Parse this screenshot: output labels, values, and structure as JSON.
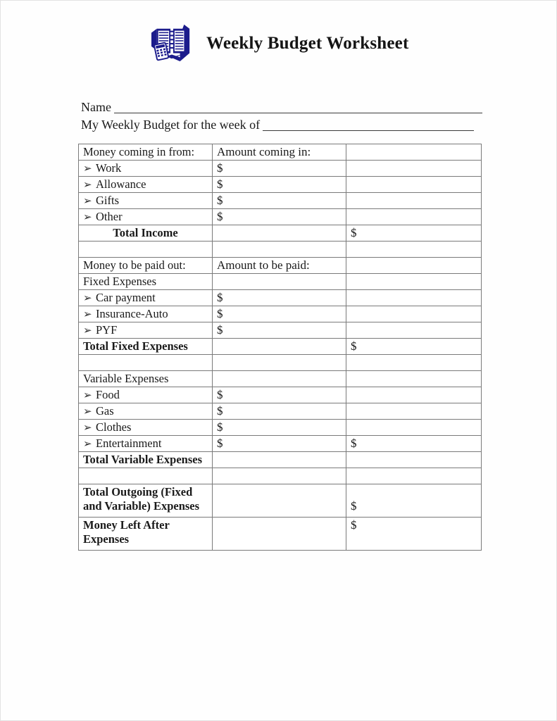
{
  "document": {
    "title": "Weekly Budget Worksheet",
    "logo_icon": "budget-book-calculator-icon",
    "logo_color": "#1c1c8c"
  },
  "fields": [
    {
      "label": "Name",
      "value": "",
      "rule": "long"
    },
    {
      "label": "My Weekly Budget for the week of",
      "value": "",
      "rule": "short"
    }
  ],
  "table": {
    "bullet_glyph": "➢",
    "currency_symbol": "$",
    "rows": [
      {
        "type": "header",
        "name": "income-header",
        "c1": "Money coming in from:",
        "c2": "Amount coming in:",
        "c3": ""
      },
      {
        "type": "bullet",
        "name": "income-work",
        "c1": "Work",
        "c2": "$",
        "c3": ""
      },
      {
        "type": "bullet",
        "name": "income-allowance",
        "c1": "Allowance",
        "c2": "$",
        "c3": ""
      },
      {
        "type": "bullet",
        "name": "income-gifts",
        "c1": "Gifts",
        "c2": "$",
        "c3": ""
      },
      {
        "type": "bullet",
        "name": "income-other",
        "c1": "Other",
        "c2": "$",
        "c3": ""
      },
      {
        "type": "total-center",
        "name": "total-income",
        "c1": "Total Income",
        "c2": "",
        "c3": "$"
      },
      {
        "type": "spacer",
        "name": "spacer-1",
        "c1": "",
        "c2": "",
        "c3": ""
      },
      {
        "type": "header",
        "name": "outgoing-header",
        "c1": "Money to be paid out:",
        "c2": "Amount to be paid:",
        "c3": ""
      },
      {
        "type": "sub",
        "name": "fixed-expenses-group",
        "c1": "Fixed Expenses",
        "c2": "",
        "c3": ""
      },
      {
        "type": "bullet",
        "name": "fixed-car-payment",
        "c1": "Car payment",
        "c2": "$",
        "c3": ""
      },
      {
        "type": "bullet",
        "name": "fixed-insurance-auto",
        "c1": "Insurance-Auto",
        "c2": "$",
        "c3": ""
      },
      {
        "type": "bullet",
        "name": "fixed-pyf",
        "c1": "PYF",
        "c2": "$",
        "c3": ""
      },
      {
        "type": "total-left",
        "name": "total-fixed-expenses",
        "c1": "Total Fixed Expenses",
        "c2": "",
        "c3": "$"
      },
      {
        "type": "spacer",
        "name": "spacer-2",
        "c1": "",
        "c2": "",
        "c3": ""
      },
      {
        "type": "sub",
        "name": "variable-expenses-group",
        "c1": "Variable Expenses",
        "c2": "",
        "c3": ""
      },
      {
        "type": "bullet",
        "name": "variable-food",
        "c1": "Food",
        "c2": "$",
        "c3": ""
      },
      {
        "type": "bullet",
        "name": "variable-gas",
        "c1": "Gas",
        "c2": "$",
        "c3": ""
      },
      {
        "type": "bullet",
        "name": "variable-clothes",
        "c1": "Clothes",
        "c2": "$",
        "c3": ""
      },
      {
        "type": "bullet",
        "name": "variable-entertainment",
        "c1": "Entertainment",
        "c2": "$",
        "c3": "$"
      },
      {
        "type": "total-left",
        "name": "total-variable-expenses",
        "c1": "Total Variable Expenses",
        "c2": "",
        "c3": ""
      },
      {
        "type": "spacer",
        "name": "spacer-3",
        "c1": "",
        "c2": "",
        "c3": ""
      },
      {
        "type": "total-multi",
        "name": "total-outgoing-expenses",
        "c1": "Total Outgoing (Fixed and Variable) Expenses",
        "c2": "",
        "c3": "$",
        "c3_low": true
      },
      {
        "type": "total-multi",
        "name": "money-left-after-expenses",
        "c1": "Money Left After Expenses",
        "c2": "",
        "c3": "$"
      }
    ]
  }
}
